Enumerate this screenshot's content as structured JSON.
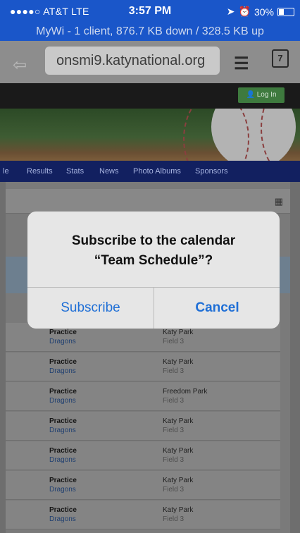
{
  "status": {
    "carrier": "●●●●○ AT&T  LTE",
    "time": "3:57 PM",
    "battery": "30%",
    "hotspot": "MyWi - 1 client, 876.7 KB down / 328.5 KB up"
  },
  "browser": {
    "url": "onsmi9.katynational.org",
    "tab_count": "7"
  },
  "site": {
    "login_label": "Log In",
    "nav": [
      "le",
      "Results",
      "Stats",
      "News",
      "Photo Albums",
      "Sponsors"
    ]
  },
  "events": [
    {
      "title": "Practice",
      "team": "Dragons",
      "location": "Katy Park",
      "field": "Field 3"
    },
    {
      "title": "Practice",
      "team": "Dragons",
      "location": "Katy Park",
      "field": "Field 3"
    },
    {
      "title": "Practice",
      "team": "Dragons",
      "location": "Freedom Park",
      "field": "Field 3"
    },
    {
      "title": "Practice",
      "team": "Dragons",
      "location": "Katy Park",
      "field": "Field 3"
    },
    {
      "title": "Practice",
      "team": "Dragons",
      "location": "Katy Park",
      "field": "Field 3"
    },
    {
      "title": "Practice",
      "team": "Dragons",
      "location": "Katy Park",
      "field": "Field 3"
    },
    {
      "title": "Practice",
      "team": "Dragons",
      "location": "Katy Park",
      "field": "Field 3"
    }
  ],
  "dialog": {
    "title_line1": "Subscribe to the calendar",
    "title_line2": "“Team Schedule”?",
    "subscribe": "Subscribe",
    "cancel": "Cancel"
  }
}
